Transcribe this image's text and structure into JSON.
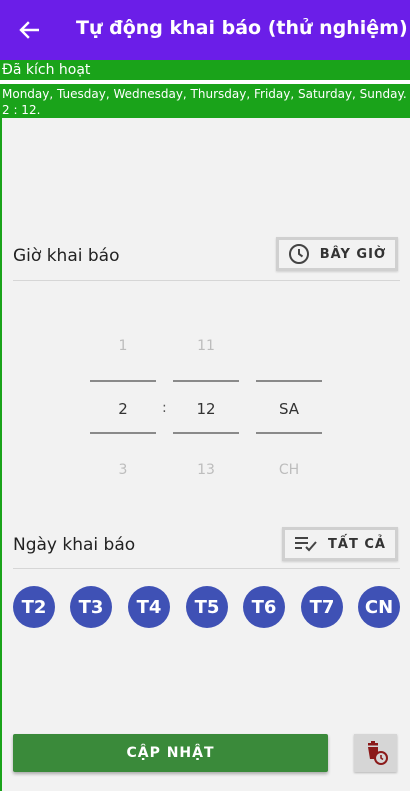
{
  "header": {
    "title": "Tự động khai báo (thử nghiệm)"
  },
  "status": {
    "activated": "Đã kích hoạt",
    "schedule_line1": "Monday, Tuesday, Wednesday, Thursday, Friday, Saturday, Sunday.",
    "schedule_line2": "2 : 12."
  },
  "time_section": {
    "label": "Giờ khai báo",
    "now_button": "BÂY GIỜ"
  },
  "time_picker": {
    "hour": {
      "prev": "1",
      "value": "2",
      "next": "3"
    },
    "separator": ":",
    "minute": {
      "prev": "11",
      "value": "12",
      "next": "13"
    },
    "ampm": {
      "prev": "",
      "value": "SA",
      "next": "CH"
    }
  },
  "day_section": {
    "label": "Ngày khai báo",
    "all_button": "TẤT CẢ"
  },
  "days": [
    "T2",
    "T3",
    "T4",
    "T5",
    "T6",
    "T7",
    "CN"
  ],
  "actions": {
    "update": "CẬP NHẬT"
  },
  "colors": {
    "app_bar": "#6b1ee8",
    "status_green": "#1aa31a",
    "day_chip": "#3f51b5",
    "update_button": "#3a8a3a",
    "delete_icon": "#8b1a1a"
  },
  "icons": {
    "back": "arrow-left-icon",
    "now": "clock-icon",
    "all": "checklist-icon",
    "delete": "delete-schedule-icon"
  }
}
